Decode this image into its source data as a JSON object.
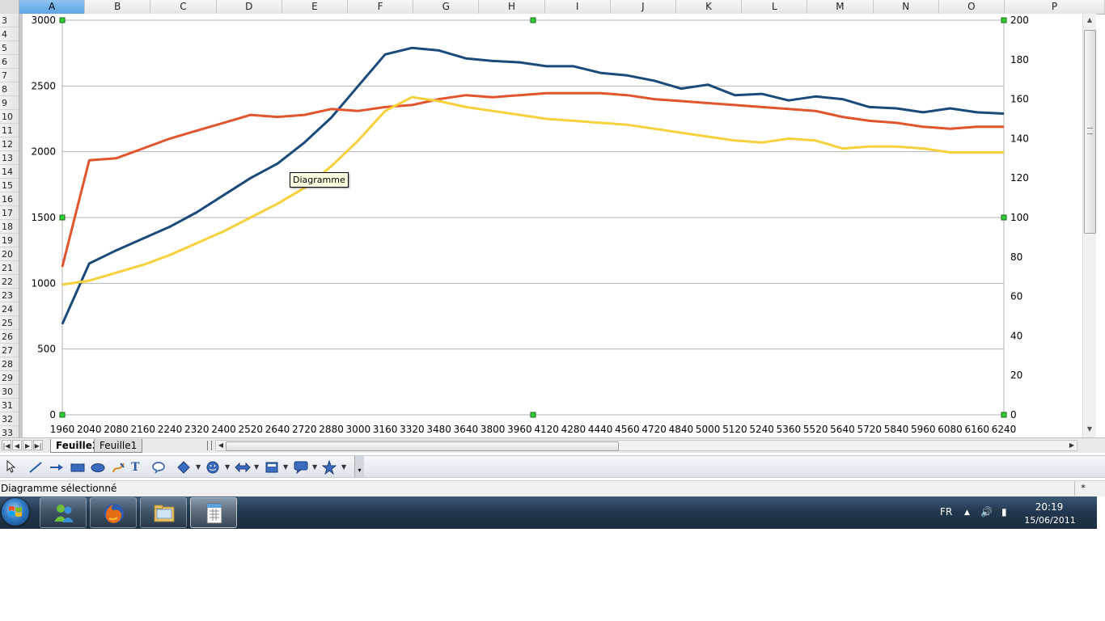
{
  "columns": [
    {
      "label": "A",
      "selected": true
    },
    {
      "label": "B"
    },
    {
      "label": "C"
    },
    {
      "label": "D"
    },
    {
      "label": "E"
    },
    {
      "label": "F"
    },
    {
      "label": "G"
    },
    {
      "label": "H"
    },
    {
      "label": "I"
    },
    {
      "label": "J"
    },
    {
      "label": "K"
    },
    {
      "label": "L"
    },
    {
      "label": "M"
    },
    {
      "label": "N"
    },
    {
      "label": "O"
    },
    {
      "label": "P"
    }
  ],
  "rows": [
    "3",
    "4",
    "5",
    "6",
    "7",
    "8",
    "9",
    "10",
    "11",
    "12",
    "13",
    "14",
    "15",
    "16",
    "17",
    "18",
    "19",
    "20",
    "21",
    "22",
    "23",
    "24",
    "25",
    "26",
    "27",
    "28",
    "29",
    "30",
    "31",
    "32",
    "33"
  ],
  "tooltip": "Diagramme",
  "chart_data": {
    "type": "line",
    "x": [
      1960,
      2040,
      2080,
      2160,
      2240,
      2320,
      2400,
      2520,
      2640,
      2720,
      2880,
      3000,
      3160,
      3320,
      3480,
      3640,
      3800,
      3960,
      4120,
      4280,
      4440,
      4560,
      4720,
      4840,
      5000,
      5120,
      5240,
      5360,
      5520,
      5640,
      5720,
      5840,
      5960,
      6080,
      6160,
      6240
    ],
    "y_left": {
      "min": 0,
      "max": 3000,
      "ticks": [
        0,
        500,
        1000,
        1500,
        2000,
        2500,
        3000
      ]
    },
    "y_right": {
      "min": 0,
      "max": 200,
      "ticks": [
        0,
        20,
        40,
        60,
        80,
        100,
        120,
        140,
        160,
        180,
        200
      ]
    },
    "grid": true,
    "legend": "none",
    "series": [
      {
        "color": "#1a4a7a",
        "axis": "left",
        "values": [
          690,
          1150,
          1250,
          1340,
          1430,
          1540,
          1670,
          1800,
          1910,
          2070,
          2260,
          2500,
          2740,
          2790,
          2770,
          2710,
          2690,
          2680,
          2650,
          2650,
          2600,
          2580,
          2540,
          2480,
          2510,
          2430,
          2440,
          2390,
          2420,
          2400,
          2340,
          2330,
          2300,
          2330,
          2300,
          2290
        ]
      },
      {
        "color": "#e1552d",
        "axis": "right",
        "values": [
          75,
          129,
          130,
          135,
          140,
          144,
          148,
          152,
          151,
          152,
          155,
          154,
          156,
          157,
          160,
          162,
          161,
          162,
          163,
          163,
          163,
          162,
          160,
          159,
          158,
          157,
          156,
          155,
          154,
          151,
          149,
          148,
          146,
          145,
          146,
          146
        ]
      },
      {
        "color": "#f7d03c",
        "axis": "right",
        "values": [
          66,
          68,
          72,
          76,
          81,
          87,
          93,
          100,
          107,
          115,
          126,
          139,
          154,
          161,
          159,
          156,
          154,
          152,
          150,
          149,
          148,
          147,
          145,
          143,
          141,
          139,
          138,
          140,
          139,
          135,
          136,
          136,
          135,
          133,
          133,
          133
        ]
      }
    ]
  },
  "sheet_tabs": {
    "nav": [
      "|◀",
      "◀",
      "▶",
      "▶|"
    ],
    "tabs": [
      "Feuille2",
      "Feuille1"
    ],
    "active": "Feuille2"
  },
  "drawbar": {
    "icons": [
      "select-arrow",
      "line",
      "arrow",
      "rectangle",
      "ellipse",
      "freeform",
      "text",
      "callout",
      "basic-shapes",
      "symbol-shapes",
      "block-arrows",
      "flowchart",
      "callouts",
      "stars"
    ]
  },
  "status": {
    "text": "Diagramme sélectionné",
    "modified": "*"
  },
  "taskbar": {
    "apps": [
      "messenger",
      "firefox",
      "explorer",
      "spreadsheet"
    ],
    "active": "spreadsheet",
    "lang": "FR",
    "time": "20:19",
    "date": "15/06/2011",
    "tray_expand": "▲",
    "volume": "🔊",
    "power": "▮"
  }
}
